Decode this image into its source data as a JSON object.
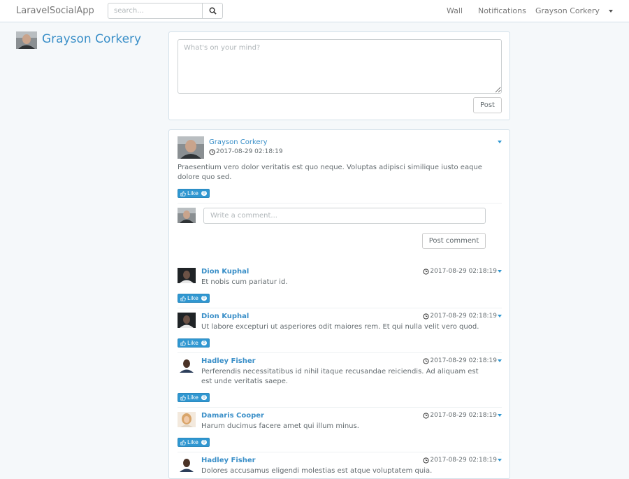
{
  "nav": {
    "brand": "LaravelSocialApp",
    "search_placeholder": "search...",
    "links": {
      "wall": "Wall",
      "notifications": "Notifications",
      "user": "Grayson Corkery"
    }
  },
  "profile": {
    "name": "Grayson Corkery"
  },
  "composer": {
    "placeholder": "What's on your mind?",
    "post_label": "Post"
  },
  "post": {
    "author": "Grayson Corkery",
    "time": "2017-08-29 02:18:19",
    "body": "Praesentium vero dolor veritatis est quo neque. Voluptas adipisci similique iusto eaque dolore quo sed.",
    "like_label": "Like",
    "like_count": "0"
  },
  "comment_form": {
    "placeholder": "Write a comment...",
    "submit_label": "Post comment"
  },
  "comments": [
    {
      "author": "Dion Kuphal",
      "time": "2017-08-29 02:18:19",
      "text": "Et nobis cum pariatur id.",
      "like_label": "Like",
      "like_count": "0"
    },
    {
      "author": "Dion Kuphal",
      "time": "2017-08-29 02:18:19",
      "text": "Ut labore excepturi ut asperiores odit maiores rem. Et qui nulla velit vero quod.",
      "like_label": "Like",
      "like_count": "0"
    },
    {
      "author": "Hadley Fisher",
      "time": "2017-08-29 02:18:19",
      "text": "Perferendis necessitatibus id nihil itaque recusandae reiciendis. Ad aliquam est est unde veritatis saepe.",
      "like_label": "Like",
      "like_count": "0"
    },
    {
      "author": "Damaris Cooper",
      "time": "2017-08-29 02:18:19",
      "text": "Harum ducimus facere amet qui illum minus.",
      "like_label": "Like",
      "like_count": "0"
    },
    {
      "author": "Hadley Fisher",
      "time": "2017-08-29 02:18:19",
      "text": "Dolores accusamus eligendi molestias est atque voluptatem quia."
    }
  ],
  "colors": {
    "accent": "#3097d1",
    "link": "#3a8fc8",
    "background": "#f5f8fa"
  }
}
